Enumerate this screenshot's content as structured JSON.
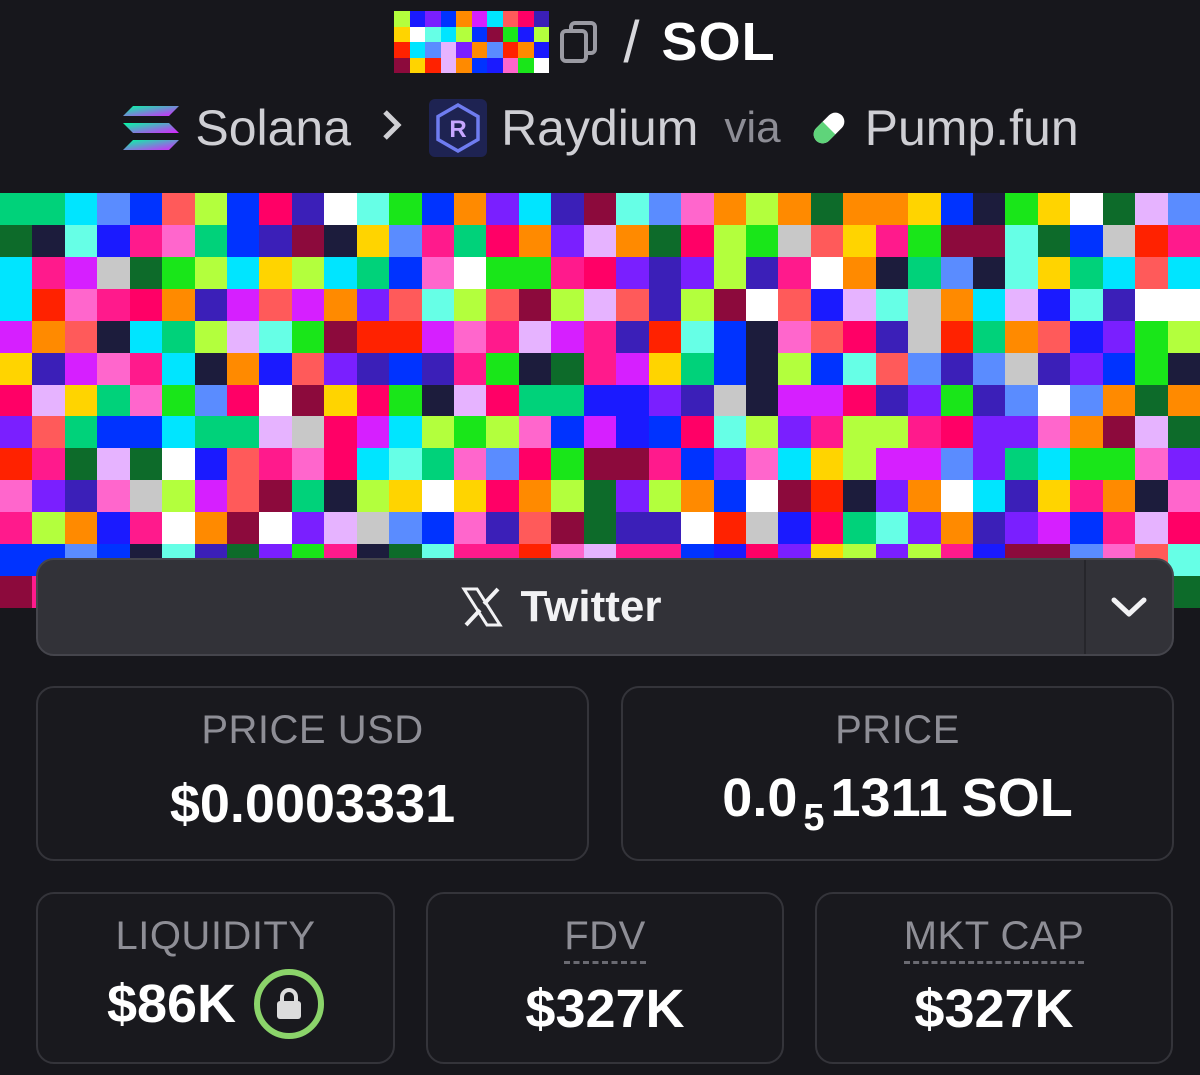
{
  "header": {
    "token_image": "pixelated-token-avatar",
    "copy_icon": "copy-icon",
    "separator": "/",
    "quote_symbol": "SOL"
  },
  "chain": {
    "chain_name": "Solana",
    "chain_icon": "solana-icon",
    "separator_icon": "chevron-right-icon",
    "dex_name": "Raydium",
    "dex_icon": "raydium-icon",
    "via_text": "via",
    "launchpad_name": "Pump.fun",
    "launchpad_icon": "pill-icon"
  },
  "banner": {
    "image": "pixelated-banner-image"
  },
  "socials": {
    "twitter_label": "Twitter",
    "twitter_icon": "x-icon",
    "dropdown_icon": "chevron-down-icon"
  },
  "stats": {
    "price_usd": {
      "label": "PRICE USD",
      "value": "$0.0003331"
    },
    "price": {
      "label": "PRICE",
      "prefix": "0.0",
      "subscript": "5",
      "digits": "1311",
      "unit": "SOL"
    },
    "liquidity": {
      "label": "LIQUIDITY",
      "value": "$86K",
      "lock_icon": "lock-icon"
    },
    "fdv": {
      "label": "FDV",
      "value": "$327K"
    },
    "mkt_cap": {
      "label": "MKT CAP",
      "value": "$327K"
    }
  },
  "colors": {
    "background": "#17171c",
    "card_border": "#34343a",
    "label_gray": "#8e8e96",
    "lock_green": "#8bd46a",
    "social_bar": "#323238"
  }
}
